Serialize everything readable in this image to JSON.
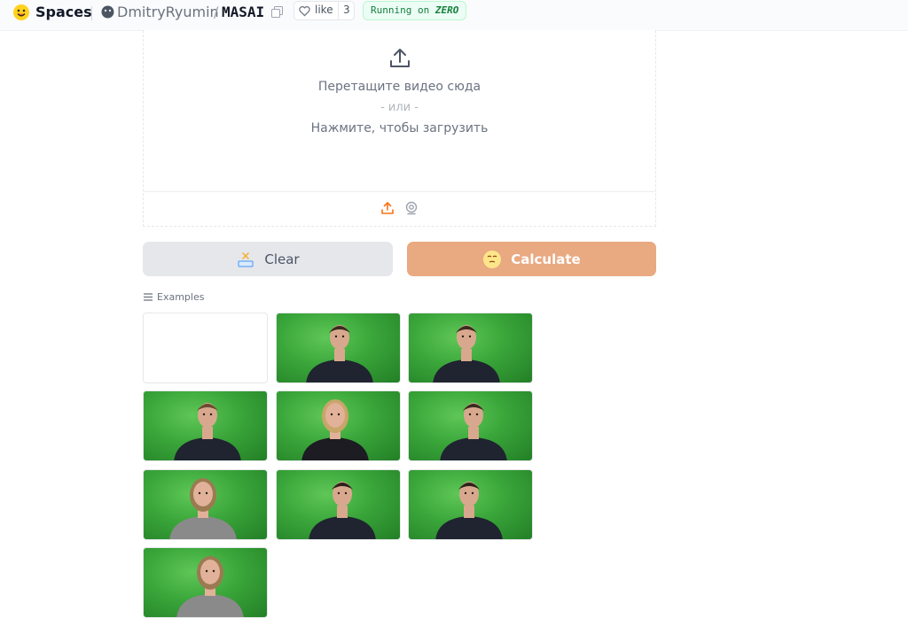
{
  "header": {
    "spaces_label": "Spaces",
    "owner": "DmitryRyumin",
    "separator": "/",
    "repo": "MASAI",
    "like_label": "like",
    "like_count": "3",
    "status_prefix": "Running on",
    "status_hardware": "ZERO"
  },
  "upload": {
    "drop_text": "Перетащите видео сюда",
    "or_text": "- или -",
    "click_text": "Нажмите, чтобы загрузить",
    "sources": [
      "upload-icon",
      "webcam-icon"
    ]
  },
  "buttons": {
    "clear_label": "Clear",
    "calculate_label": "Calculate"
  },
  "examples": {
    "label": "Examples",
    "items": [
      {
        "empty": true
      },
      {
        "person": "man",
        "shirt": "#1f2430",
        "hair": "#3b2a1f",
        "skin": "#d8a88e"
      },
      {
        "person": "man",
        "shirt": "#1f2430",
        "hair": "#3b2a1f",
        "skin": "#d8a88e"
      },
      {
        "person": "man",
        "shirt": "#1f2430",
        "hair": "#6b4a2f",
        "skin": "#d8a88e"
      },
      {
        "person": "woman",
        "shirt": "#1c1c22",
        "hair": "#c9a56a",
        "skin": "#e1b199"
      },
      {
        "person": "man",
        "shirt": "#1f2430",
        "hair": "#3b2a1f",
        "skin": "#d8a88e"
      },
      {
        "person": "woman",
        "shirt": "#8a8a8a",
        "hair": "#9b7a52",
        "skin": "#e1b199"
      },
      {
        "person": "man",
        "shirt": "#1f2430",
        "hair": "#2d2019",
        "skin": "#d8a88e"
      },
      {
        "person": "man",
        "shirt": "#1f2430",
        "hair": "#2d2019",
        "skin": "#d8a88e"
      },
      {
        "person": "woman",
        "shirt": "#8a8a8a",
        "hair": "#9b7a52",
        "skin": "#e1b199"
      }
    ]
  },
  "colors": {
    "accent": "#e9a981",
    "status_green": "#15803d",
    "chroma_green": "#3aa63a"
  }
}
